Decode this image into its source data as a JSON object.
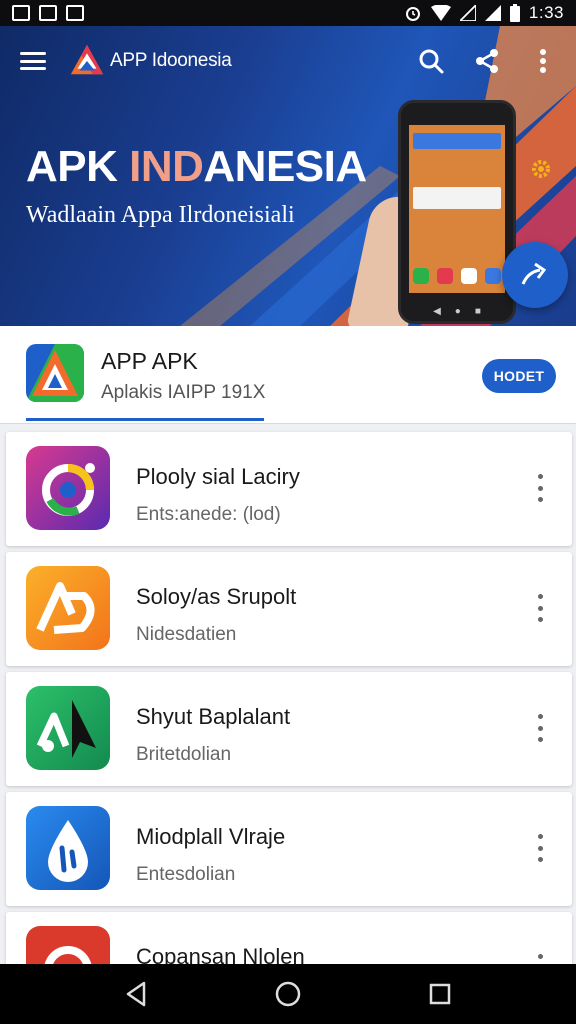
{
  "status_bar": {
    "time": "1:33",
    "left_icons": [
      "gallery-icon",
      "image-icon",
      "check-icon"
    ],
    "right_icons": [
      "alarm-icon",
      "wifi-icon",
      "signal-icon",
      "signal-icon",
      "battery-icon"
    ]
  },
  "toolbar": {
    "title": "APP Idoonesia",
    "actions": [
      "search-icon",
      "share-icon",
      "more-vertical-icon"
    ]
  },
  "hero": {
    "title_part1": "APK ",
    "title_accent": "IND",
    "title_part2": "ANESIA",
    "subtitle": "Wadlaain Appa Ilrdoneisiali"
  },
  "summary": {
    "name": "APP APK",
    "subtitle": "Aplakis IAIPP 191X",
    "button_label": "HODET"
  },
  "apps": [
    {
      "title": "Plooly sial Laciry",
      "subtitle": "Ents:anede: (lod)",
      "icon": "swirl-icon",
      "color": "#7a2fb0"
    },
    {
      "title": "Soloy/as Srupolt",
      "subtitle": "Nidesdatien",
      "icon": "ab-icon",
      "color": "#f59a1c"
    },
    {
      "title": "Shyut Baplalant",
      "subtitle": "Britetdolian",
      "icon": "arrow-cursor-icon",
      "color": "#22a861"
    },
    {
      "title": "Miodplall Vlraje",
      "subtitle": "Entesdolian",
      "icon": "droplet-icon",
      "color": "#1c74d6"
    },
    {
      "title": "Copansan Nlolen",
      "subtitle": "",
      "icon": "power-icon",
      "color": "#d93a2c"
    }
  ],
  "nav": [
    "back-icon",
    "home-icon",
    "recents-icon"
  ],
  "colors": {
    "primary": "#1f5fc9",
    "hero_dark": "#0f2a66",
    "accent_orange": "#f36a2d"
  }
}
